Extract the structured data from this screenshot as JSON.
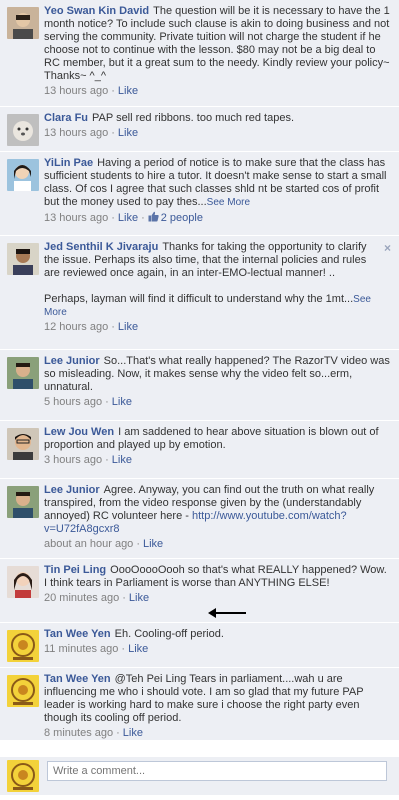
{
  "comments": [
    {
      "author": "Yeo Swan Kin David",
      "text": "The question will be it is necessary to have the 1 month notice? To include such clause is akin to doing business and not serving the community. Private tuition will not charge the student if he choose not to continue with the lesson. $80 may not be a big deal to RC member, but it a great sum to the needy. Kindly review your policy~ Thanks~ ^_^",
      "time": "13 hours ago",
      "like": "Like"
    },
    {
      "author": "Clara Fu",
      "text": "PAP sell red ribbons. too much red tapes.",
      "time": "13 hours ago",
      "like": "Like"
    },
    {
      "author": "YiLin Pae",
      "text": "Having a period of notice is to make sure that the class has sufficient students to hire a tutor. It doesn't make sense to start a small class. Of cos I agree that such classes shld nt be started cos of profit but the money used to pay thes...",
      "see_more": "See More",
      "time": "13 hours ago",
      "like": "Like",
      "likes_count": "2 people"
    },
    {
      "author": "Jed Senthil K Jivaraju",
      "text": "Thanks for taking the opportunity to clarify the issue. Perhaps its also time, that the internal policies and rules are reviewed once again, in an inter-EMO-lectual manner! ..\n\nPerhaps, layman will find it difficult to understand why the 1mt...",
      "see_more": "See More",
      "time": "12 hours ago",
      "like": "Like",
      "close": "×"
    },
    {
      "author": "Lee Junior",
      "text": "So...That's what really happened? The RazorTV video was so misleading. Now, it makes sense why the video felt so...erm, unnatural.",
      "time": "5 hours ago",
      "like": "Like"
    },
    {
      "author": "Lew Jou Wen",
      "text": "I am saddened to hear above situation is blown out of proportion and played up by emotion.",
      "time": "3 hours ago",
      "like": "Like"
    },
    {
      "author": "Lee Junior",
      "text": "Agree. Anyway, you can find out the truth on what really transpired, from the video response given by the (understandably annoyed) RC volunteer here -",
      "url": "http://www.youtube.com/watch?v=U72fA8gcxr8",
      "time": "about an hour ago",
      "like": "Like"
    },
    {
      "author": "Tin Pei Ling",
      "text": "OooOoooOooh so that's what REALLY happened? Wow. I think tears in Parliament is worse than ANYTHING ELSE!",
      "time": "20 minutes ago",
      "like": "Like"
    },
    {
      "author": "Tan Wee Yen",
      "text": "Eh. Cooling-off period.",
      "time": "11 minutes ago",
      "like": "Like"
    },
    {
      "author": "Tan Wee Yen",
      "text": "@Teh Pei Ling Tears in parliament....wah u are influencing me who i should vote. I am so glad that my future PAP leader is working hard to make sure i choose the right party even though its cooling off period.",
      "time": "8 minutes ago",
      "like": "Like"
    }
  ],
  "composer": {
    "placeholder": "Write a comment..."
  },
  "colors": {
    "link": "#3b5998",
    "background": "#edeff4",
    "meta": "#808080"
  }
}
